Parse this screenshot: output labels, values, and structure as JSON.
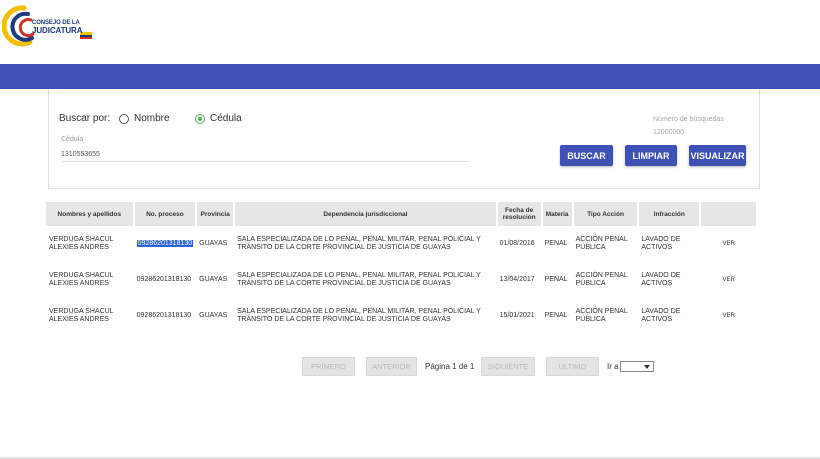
{
  "header": {
    "logo_line1": "CONSEJO DE LA",
    "logo_line2": "JUDICATURA"
  },
  "search": {
    "buscar_por_label": "Buscar por:",
    "option_nombre": "Nombre",
    "option_cedula": "Cédula",
    "selected": "Cédula",
    "cedula_label": "Cédula",
    "cedula_value": "1310553655",
    "busquedas_label": "Número de búsquedas",
    "busquedas_value": "12000000",
    "btn_buscar": "BUSCAR",
    "btn_limpiar": "LIMPIAR",
    "btn_visualizar": "VISUALIZAR"
  },
  "table": {
    "headers": [
      "Nombres y apellidos",
      "No. proceso",
      "Provincia",
      "Dependencia jurisdiccional",
      "Fecha de resolución",
      "Materia",
      "Tipo Acción",
      "Infracción",
      ""
    ],
    "rows": [
      {
        "nombre": "VERDUGA SHACUL ALEXIES ANDRES",
        "proceso": "09286201318130",
        "provincia": "GUAYAS",
        "dependencia": "SALA ESPECIALIZADA DE LO PENAL, PENAL MILITAR, PENAL POLICIAL Y TRÁNSITO DE LA CORTE PROVINCIAL DE JUSTICIA DE GUAYAS",
        "fecha": "01/08/2016",
        "materia": "PENAL",
        "tipo": "ACCIÓN PENAL PÚBLICA",
        "infraccion": "LAVADO DE ACTIVOS",
        "accion": "VER"
      },
      {
        "nombre": "VERDUGA SHACUL ALEXIES ANDRES",
        "proceso": "09286201318130",
        "provincia": "GUAYAS",
        "dependencia": "SALA ESPECIALIZADA DE LO PENAL, PENAL MILITAR, PENAL POLICIAL Y TRÁNSITO DE LA CORTE PROVINCIAL DE JUSTICIA DE GUAYAS",
        "fecha": "13/04/2017",
        "materia": "PENAL",
        "tipo": "ACCIÓN PENAL PÚBLICA",
        "infraccion": "LAVADO DE ACTIVOS",
        "accion": "VER"
      },
      {
        "nombre": "VERDUGA SHACUL ALEXIES ANDRES",
        "proceso": "09286201318130",
        "provincia": "GUAYAS",
        "dependencia": "SALA ESPECIALIZADA DE LO PENAL, PENAL MILITAR, PENAL POLICIAL Y TRÁNSITO DE LA CORTE PROVINCIAL DE JUSTICIA DE GUAYAS",
        "fecha": "15/01/2021",
        "materia": "PENAL",
        "tipo": "ACCIÓN PENAL PÚBLICA",
        "infraccion": "LAVADO DE ACTIVOS",
        "accion": "VER"
      }
    ]
  },
  "pagination": {
    "primero": "PRIMERO",
    "anterior": "ANTERIOR",
    "page_text": "Página 1 de 1",
    "siguiente": "SIGUIENTE",
    "ultimo": "ULTIMO",
    "goto_label": "Ir a"
  },
  "colors": {
    "primary": "#3f51b5",
    "radio_selected": "#4caf50",
    "highlight": "#2c63d6"
  }
}
